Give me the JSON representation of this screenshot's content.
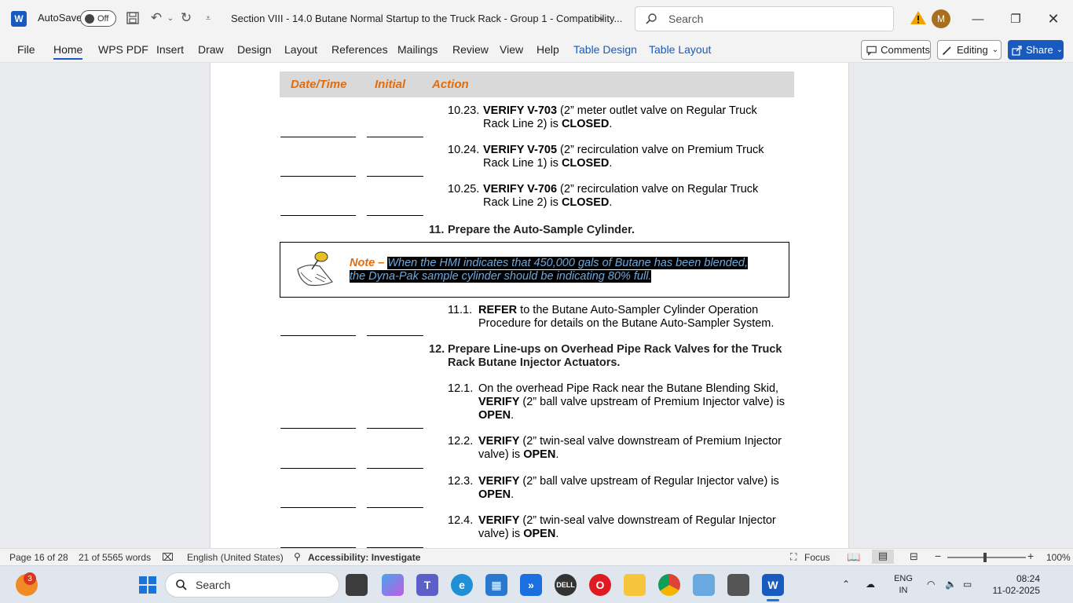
{
  "app": {
    "autosave_label": "AutoSave",
    "autosave_state": "Off",
    "doc_title": "Section VIII - 14.0 Butane Normal Startup to the Truck Rack - Group 1  -  Compatibility...",
    "search_placeholder": "Search",
    "avatar_initial": "M"
  },
  "menu": {
    "items": [
      "File",
      "Home",
      "WPS PDF",
      "Insert",
      "Draw",
      "Design",
      "Layout",
      "References",
      "Mailings",
      "Review",
      "View",
      "Help",
      "Table Design",
      "Table Layout"
    ],
    "comments": "Comments",
    "editing": "Editing",
    "share": "Share"
  },
  "doc": {
    "headers": [
      "Date/Time",
      "Initial",
      "Action"
    ],
    "steps": [
      {
        "num": "10.23.",
        "bold": "VERIFY V-703",
        "line1": " (2” meter outlet valve on Regular Truck",
        "line2": "Rack Line 2) is ",
        "end": "CLOSED",
        "tail": "."
      },
      {
        "num": "10.24.",
        "bold": "VERIFY V-705",
        "line1": " (2” recirculation valve on Premium Truck",
        "line2": "Rack Line 1) is ",
        "end": "CLOSED",
        "tail": "."
      },
      {
        "num": "10.25.",
        "bold": "VERIFY V-706",
        "line1": " (2” recirculation valve on Regular Truck",
        "line2": "Rack Line 2) is ",
        "end": "CLOSED",
        "tail": "."
      }
    ],
    "section11": {
      "num": "11.",
      "title": "Prepare the Auto-Sample Cylinder."
    },
    "note": {
      "label": "Note – ",
      "text": "When the HMI indicates that 450,000 gals of Butane has been blended, the Dyna-Pak sample cylinder should be indicating 80% full."
    },
    "step11_1": {
      "num": "11.1.",
      "bold": "REFER",
      "line1": " to the Butane Auto-Sampler Cylinder Operation",
      "line2": "Procedure for details on the Butane Auto-Sampler System."
    },
    "section12": {
      "num": "12.",
      "line1": "Prepare Line-ups on Overhead Pipe Rack Valves for the Truck",
      "line2": "Rack Butane Injector Actuators."
    },
    "step12_1": {
      "num": "12.1.",
      "line1": "On the overhead Pipe Rack near the Butane Blending Skid,",
      "bold2": "VERIFY",
      "line2": " (2” ball valve upstream of Premium Injector valve) is",
      "bold3": "OPEN",
      "tail": "."
    },
    "step12_2": {
      "num": "12.2.",
      "bold": "VERIFY",
      "line1": " (2” twin-seal valve downstream of Premium Injector",
      "line2": "valve) is ",
      "end": "OPEN",
      "tail": "."
    },
    "step12_3": {
      "num": "12.3.",
      "bold": "VERIFY",
      "line1": " (2” ball valve upstream of Regular Injector valve) is",
      "end": "OPEN",
      "tail": "."
    },
    "step12_4": {
      "num": "12.4.",
      "bold": "VERIFY",
      "line1": " (2” twin-seal valve downstream of Regular Injector",
      "line2": "valve) is ",
      "end": "OPEN",
      "tail": "."
    }
  },
  "status": {
    "page": "Page 16 of 28",
    "words": "21 of 5565 words",
    "language": "English (United States)",
    "accessibility": "Accessibility: Investigate",
    "focus": "Focus",
    "zoom": "100%"
  },
  "taskbar": {
    "search_placeholder": "Search",
    "badge": "3",
    "lang1": "ENG",
    "lang2": "IN",
    "time": "08:24",
    "date": "11-02-2025"
  }
}
